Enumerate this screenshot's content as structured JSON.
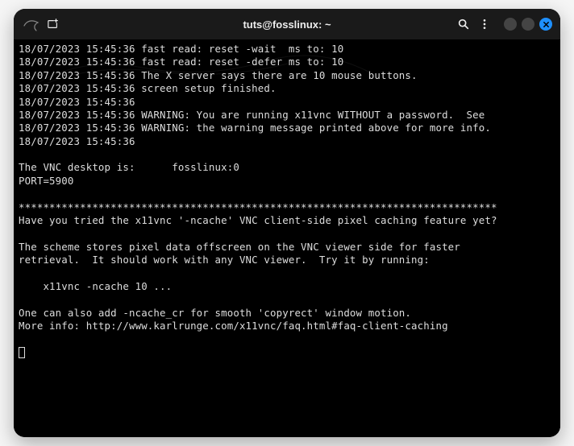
{
  "window": {
    "title": "tuts@fosslinux: ~"
  },
  "terminal": {
    "lines": [
      "18/07/2023 15:45:36 fast read: reset -wait  ms to: 10",
      "18/07/2023 15:45:36 fast read: reset -defer ms to: 10",
      "18/07/2023 15:45:36 The X server says there are 10 mouse buttons.",
      "18/07/2023 15:45:36 screen setup finished.",
      "18/07/2023 15:45:36",
      "18/07/2023 15:45:36 WARNING: You are running x11vnc WITHOUT a password.  See",
      "18/07/2023 15:45:36 WARNING: the warning message printed above for more info.",
      "18/07/2023 15:45:36",
      "",
      "The VNC desktop is:      fosslinux:0",
      "PORT=5900",
      "",
      "******************************************************************************",
      "Have you tried the x11vnc '-ncache' VNC client-side pixel caching feature yet?",
      "",
      "The scheme stores pixel data offscreen on the VNC viewer side for faster",
      "retrieval.  It should work with any VNC viewer.  Try it by running:",
      "",
      "    x11vnc -ncache 10 ...",
      "",
      "One can also add -ncache_cr for smooth 'copyrect' window motion.",
      "More info: http://www.karlrunge.com/x11vnc/faq.html#faq-client-caching",
      ""
    ]
  }
}
